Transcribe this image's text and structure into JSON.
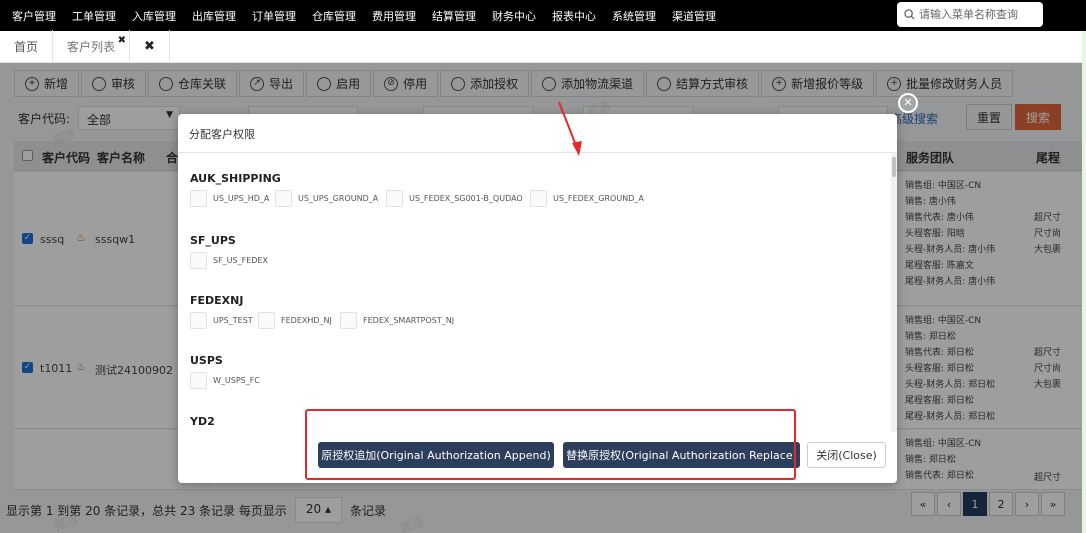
{
  "nav": {
    "menu": [
      "客户管理",
      "工单管理",
      "入库管理",
      "出库管理",
      "订单管理",
      "仓库管理",
      "费用管理",
      "结算管理",
      "财务中心",
      "报表中心",
      "系统管理",
      "渠道管理"
    ],
    "search_placeholder": "请输入菜单名称查询"
  },
  "tabs": {
    "home": "首页",
    "customer_list": "客户列表",
    "close_all": "✖"
  },
  "toolbar": [
    "新增",
    "审核",
    "仓库关联",
    "导出",
    "启用",
    "停用",
    "添加授权",
    "添加物流渠道",
    "结算方式审核",
    "新增报价等级",
    "批量修改财务人员"
  ],
  "filters": {
    "customer_code_label": "客户代码:",
    "customer_code_value": "全部",
    "advanced_search": "高级搜索",
    "reset": "重置",
    "search": "搜索"
  },
  "table": {
    "headers": [
      "客户代码",
      "客户名称",
      "合",
      "服务团队",
      "尾程"
    ],
    "rows": [
      {
        "code": "sssq",
        "name": "sssqw1",
        "team": [
          "销售组: 中国区-CN",
          "销售: 唐小伟",
          "销售代表: 唐小伟",
          "头程客服: 阳晗",
          "头程-财务人员: 唐小伟",
          "尾程客服: 陈嘉文",
          "尾程-财务人员: 唐小伟"
        ],
        "tail": [
          "超尺寸",
          "尺寸尚",
          "大包裹"
        ]
      },
      {
        "code": "t1011",
        "name": "测试24100902",
        "team": [
          "销售组: 中国区-CN",
          "销售: 郑日松",
          "销售代表: 郑日松",
          "头程客服: 郑日松",
          "头程-财务人员: 郑日松",
          "尾程客服: 郑日松",
          "尾程-财务人员: 郑日松"
        ],
        "tail": [
          "超尺寸",
          "尺寸尚",
          "大包裹"
        ]
      },
      {
        "code": "",
        "name": "",
        "team": [
          "销售组: 中国区-CN",
          "销售: 郑日松",
          "销售代表: 郑日松"
        ],
        "tail": [
          "超尺寸"
        ]
      }
    ]
  },
  "footer": {
    "summary": "显示第 1 到第 20 条记录，总共 23 条记录 每页显示",
    "page_size": "20 ▴",
    "suffix": "条记录",
    "pages": [
      "«",
      "‹",
      "1",
      "2",
      "›",
      "»"
    ]
  },
  "modal": {
    "title": "分配客户权限",
    "groups": [
      {
        "title": "AUK_SHIPPING",
        "options": [
          "US_UPS_HD_A",
          "US_UPS_GROUND_A",
          "US_FEDEX_SG001-B_QUDAO",
          "US_FEDEX_GROUND_A"
        ]
      },
      {
        "title": "SF_UPS",
        "options": [
          "SF_US_FEDEX"
        ]
      },
      {
        "title": "FEDEXNJ",
        "options": [
          "UPS_TEST",
          "FEDEXHD_NJ",
          "FEDEX_SMARTPOST_NJ"
        ]
      },
      {
        "title": "USPS",
        "options": [
          "W_USPS_FC"
        ]
      },
      {
        "title": "YD2",
        "options": []
      }
    ],
    "btn_append": "原授权追加(Original Authorization Append)",
    "btn_replace": "替换原授权(Original Authorization Replace)",
    "btn_close": "关闭(Close)"
  },
  "watermark": "郑洁"
}
